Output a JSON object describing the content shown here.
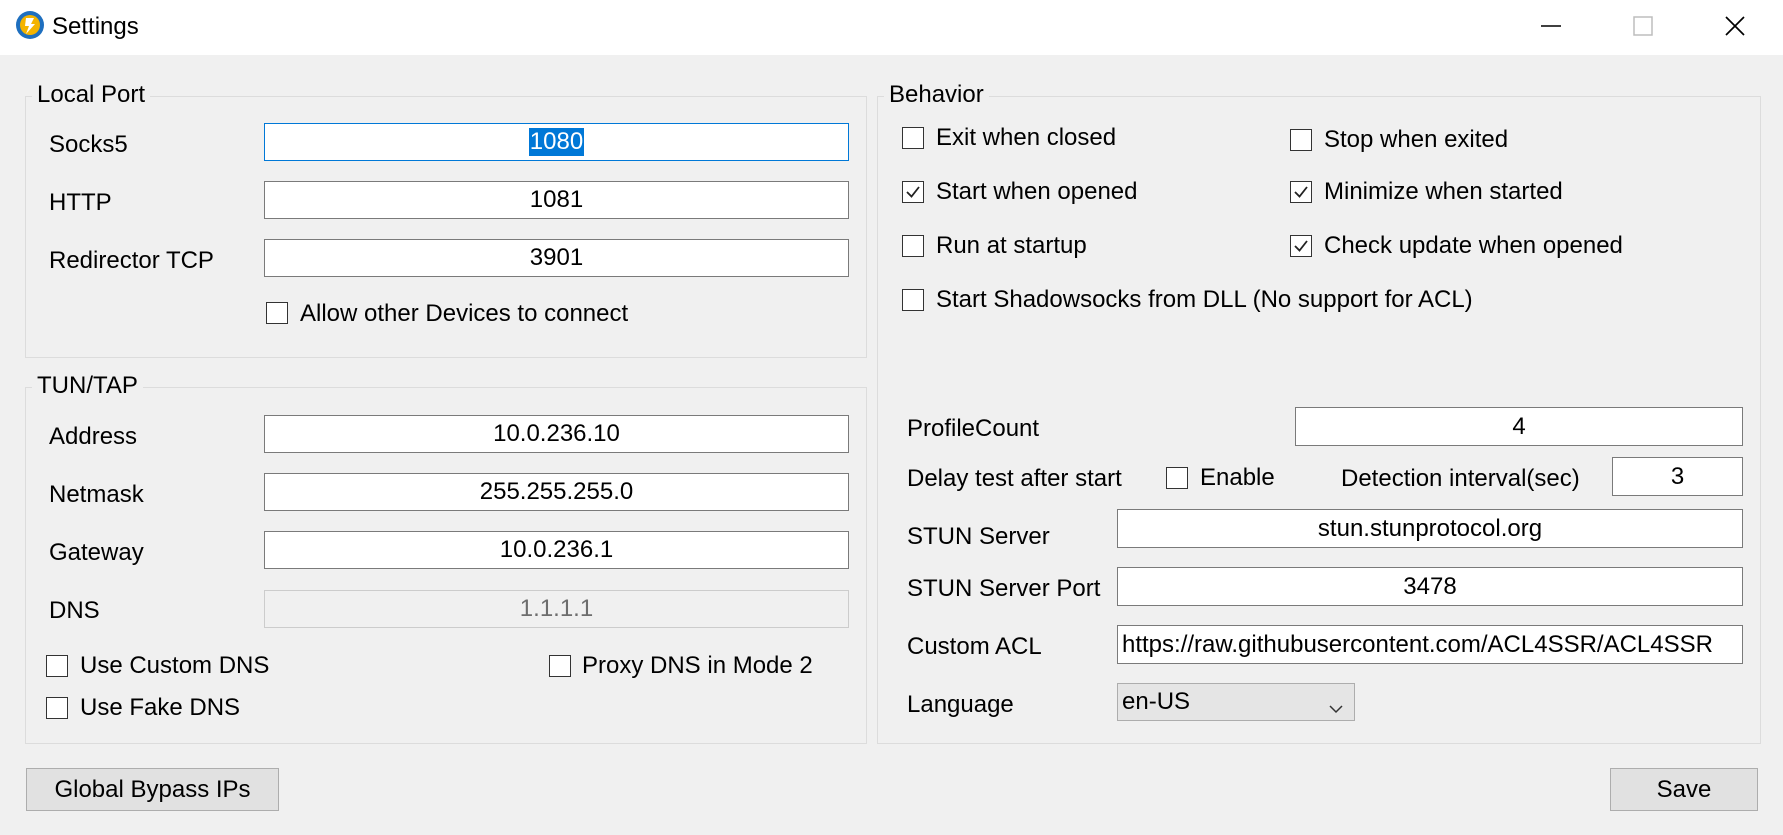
{
  "window": {
    "title": "Settings",
    "icon": "app-globe-icon",
    "controls": [
      "minimize-icon",
      "maximize-icon",
      "close-icon"
    ]
  },
  "local_port": {
    "legend": "Local Port",
    "socks5_label": "Socks5",
    "socks5_value": "1080",
    "http_label": "HTTP",
    "http_value": "1081",
    "redirector_label": "Redirector TCP",
    "redirector_value": "3901",
    "allow_devices_label": "Allow other Devices to connect",
    "allow_devices_checked": false
  },
  "tun_tap": {
    "legend": "TUN/TAP",
    "address_label": "Address",
    "address_value": "10.0.236.10",
    "netmask_label": "Netmask",
    "netmask_value": "255.255.255.0",
    "gateway_label": "Gateway",
    "gateway_value": "10.0.236.1",
    "dns_label": "DNS",
    "dns_value": "1.1.1.1",
    "use_custom_dns_label": "Use Custom DNS",
    "use_custom_dns_checked": false,
    "proxy_dns_label": "Proxy DNS in Mode 2",
    "proxy_dns_checked": false,
    "use_fake_dns_label": "Use Fake DNS",
    "use_fake_dns_checked": false
  },
  "behavior": {
    "legend": "Behavior",
    "exit_when_closed": {
      "label": "Exit when closed",
      "checked": false
    },
    "stop_when_exited": {
      "label": "Stop when exited",
      "checked": false
    },
    "start_when_opened": {
      "label": "Start when opened",
      "checked": true
    },
    "minimize_when_started": {
      "label": "Minimize when started",
      "checked": true
    },
    "run_at_startup": {
      "label": "Run at startup",
      "checked": false
    },
    "check_update": {
      "label": "Check update when opened",
      "checked": true
    },
    "start_from_dll": {
      "label": "Start Shadowsocks from DLL (No support for ACL)",
      "checked": false
    },
    "profile_count_label": "ProfileCount",
    "profile_count_value": "4",
    "delay_test_label": "Delay test after start",
    "enable_label": "Enable",
    "enable_checked": false,
    "detection_interval_label": "Detection interval(sec)",
    "detection_interval_value": "3",
    "stun_server_label": "STUN Server",
    "stun_server_value": "stun.stunprotocol.org",
    "stun_port_label": "STUN Server Port",
    "stun_port_value": "3478",
    "custom_acl_label": "Custom ACL",
    "custom_acl_value": "https://raw.githubusercontent.com/ACL4SSR/ACL4SSR",
    "language_label": "Language",
    "language_value": "en-US"
  },
  "footer": {
    "global_bypass_label": "Global Bypass IPs",
    "save_label": "Save"
  }
}
